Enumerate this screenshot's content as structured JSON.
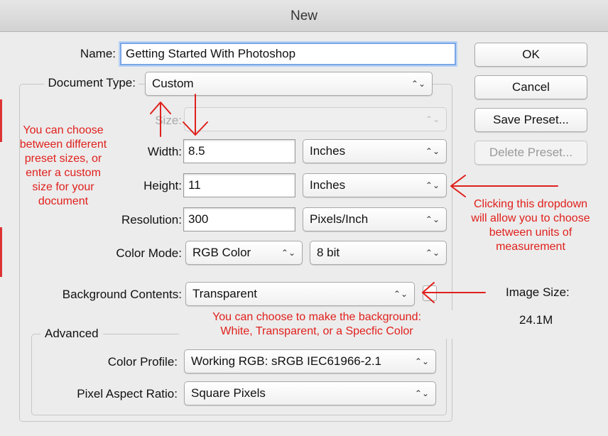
{
  "window": {
    "title": "New"
  },
  "form": {
    "name_label": "Name:",
    "name_value": "Getting Started With Photoshop",
    "document_type_label": "Document Type:",
    "document_type_value": "Custom",
    "size_label": "Size:",
    "size_value": "",
    "width_label": "Width:",
    "width_value": "8.5",
    "width_unit": "Inches",
    "height_label": "Height:",
    "height_value": "11",
    "height_unit": "Inches",
    "resolution_label": "Resolution:",
    "resolution_value": "300",
    "resolution_unit": "Pixels/Inch",
    "color_mode_label": "Color Mode:",
    "color_mode_value": "RGB Color",
    "bit_depth_value": "8 bit",
    "background_label": "Background Contents:",
    "background_value": "Transparent"
  },
  "advanced": {
    "legend": "Advanced",
    "color_profile_label": "Color Profile:",
    "color_profile_value": "Working RGB:  sRGB IEC61966-2.1",
    "pixel_aspect_label": "Pixel Aspect Ratio:",
    "pixel_aspect_value": "Square Pixels"
  },
  "buttons": {
    "ok": "OK",
    "cancel": "Cancel",
    "save_preset": "Save Preset...",
    "delete_preset": "Delete Preset..."
  },
  "image_size": {
    "label": "Image Size:",
    "value": "24.1M"
  },
  "annotations": {
    "preset_sizes": [
      "You can choose",
      "between different",
      "preset sizes, or",
      "enter a custom",
      "size for your",
      "document"
    ],
    "units_dropdown": [
      "Clicking this dropdown",
      "will allow you to choose",
      "between units of",
      "measurement"
    ],
    "background": [
      "You can choose to make the background:",
      "White, Transparent, or a Specfic Color"
    ]
  },
  "colors": {
    "annotation": "#e0201c",
    "focus_ring": "#7aa7e5"
  }
}
